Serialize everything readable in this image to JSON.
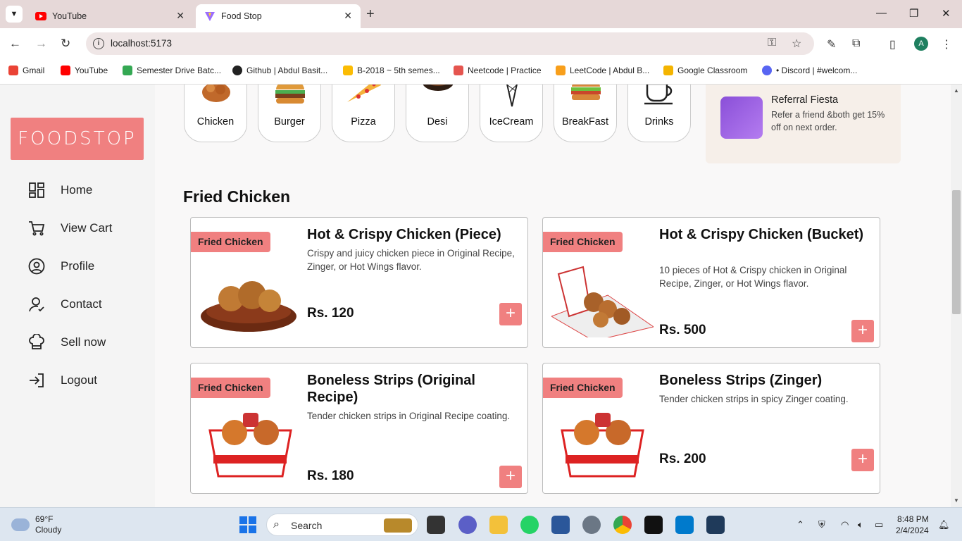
{
  "browser": {
    "tabs": [
      {
        "label": "YouTube",
        "active": false
      },
      {
        "label": "Food Stop",
        "active": true
      }
    ],
    "url": "localhost:5173",
    "profile_initial": "A",
    "bookmarks": [
      {
        "label": "Gmail",
        "color": "#ea4335"
      },
      {
        "label": "YouTube",
        "color": "#ff0000"
      },
      {
        "label": "Semester Drive Batc...",
        "color": "#34a853"
      },
      {
        "label": "Github | Abdul Basit...",
        "color": "#222222"
      },
      {
        "label": "B-2018 ~ 5th semes...",
        "color": "#fbbc04"
      },
      {
        "label": "Neetcode | Practice",
        "color": "#e5554f"
      },
      {
        "label": "LeetCode | Abdul B...",
        "color": "#f89f1b"
      },
      {
        "label": "Google Classroom",
        "color": "#f4b400"
      },
      {
        "label": "• Discord | #welcom...",
        "color": "#5865f2"
      }
    ]
  },
  "brand": {
    "logo_text": "FOODSTOP",
    "accent": "#f08080"
  },
  "sidebar": {
    "items": [
      {
        "label": "Home",
        "icon": "grid-icon"
      },
      {
        "label": "View Cart",
        "icon": "cart-icon"
      },
      {
        "label": "Profile",
        "icon": "user-circle-icon"
      },
      {
        "label": "Contact",
        "icon": "contact-icon"
      },
      {
        "label": "Sell now",
        "icon": "chef-hat-icon"
      },
      {
        "label": "Logout",
        "icon": "logout-icon"
      }
    ]
  },
  "categories": [
    "Chicken",
    "Burger",
    "Pizza",
    "Desi",
    "IceCream",
    "BreakFast",
    "Drinks"
  ],
  "referral": {
    "title": "Referral Fiesta",
    "description": "Refer a friend &both get 15% off on next order."
  },
  "section_title": "Fried Chicken",
  "products": [
    {
      "badge": "Fried Chicken",
      "title": "Hot & Crispy Chicken (Piece)",
      "description": "Crispy and juicy chicken piece in Original Recipe, Zinger, or Hot Wings flavor.",
      "price": "Rs. 120"
    },
    {
      "badge": "Fried Chicken",
      "title": "Hot & Crispy Chicken (Bucket)",
      "description": "10 pieces of Hot & Crispy chicken in Original Recipe, Zinger, or Hot Wings flavor.",
      "price": "Rs. 500"
    },
    {
      "badge": "Fried Chicken",
      "title": "Boneless Strips (Original Recipe)",
      "description": "Tender chicken strips in Original Recipe coating.",
      "price": "Rs. 180"
    },
    {
      "badge": "Fried Chicken",
      "title": "Boneless Strips (Zinger)",
      "description": "Tender chicken strips in spicy Zinger coating.",
      "price": "Rs. 200"
    }
  ],
  "add_label": "+",
  "taskbar": {
    "weather_temp": "69°F",
    "weather_desc": "Cloudy",
    "search_placeholder": "Search",
    "time": "8:48 PM",
    "date": "2/4/2024"
  }
}
